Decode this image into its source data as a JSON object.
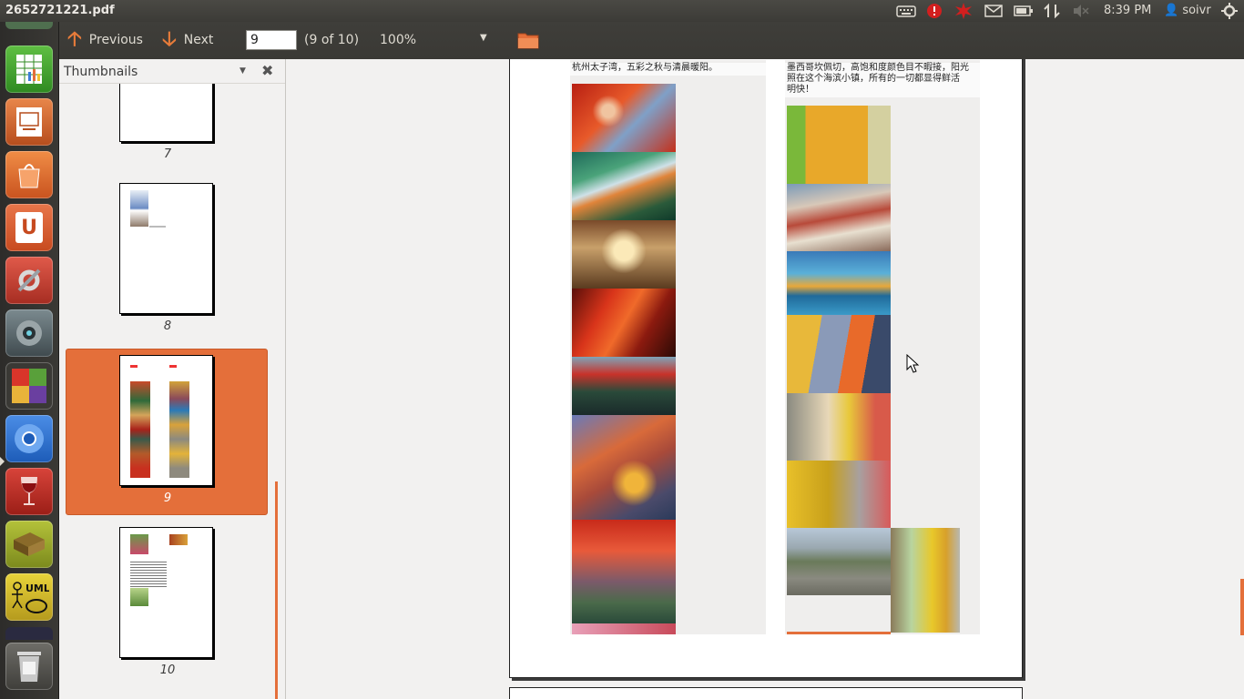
{
  "window": {
    "title": "2652721221.pdf"
  },
  "panel": {
    "time": "8:39 PM",
    "user": "soivr",
    "indicators": [
      "keyboard-icon",
      "update-alert-icon",
      "error-icon",
      "mail-icon",
      "battery-icon",
      "network-icon",
      "volume-muted-icon",
      "gear-icon"
    ]
  },
  "launcher": {
    "items": [
      "libreoffice-calc",
      "libreoffice-impress",
      "ubuntu-software-center",
      "ubuntu-one",
      "system-settings",
      "webcam-app",
      "workspace-switcher",
      "chromium",
      "wine",
      "book-reader",
      "uml-tool",
      "trash"
    ]
  },
  "toolbar": {
    "previous_label": "Previous",
    "next_label": "Next",
    "page_value": "9",
    "page_count": "(9 of 10)",
    "zoom": "100%"
  },
  "sidebar": {
    "title": "Thumbnails",
    "pages": [
      "7",
      "8",
      "9",
      "10"
    ],
    "selected": "9"
  },
  "document": {
    "left_caption": "杭州太子湾，五彩之秋与清晨暖阳。",
    "right_caption_line1": "墨西哥坎佩切，高饱和度颜色目不暇接，阳光",
    "right_caption_line2": "照在这个海滨小镇，所有的一切都显得鲜活",
    "right_caption_line3": "明快！"
  },
  "colors": {
    "accent": "#e46f3a",
    "panel": "#3c3b37",
    "launcher": "#2d2c2a"
  }
}
